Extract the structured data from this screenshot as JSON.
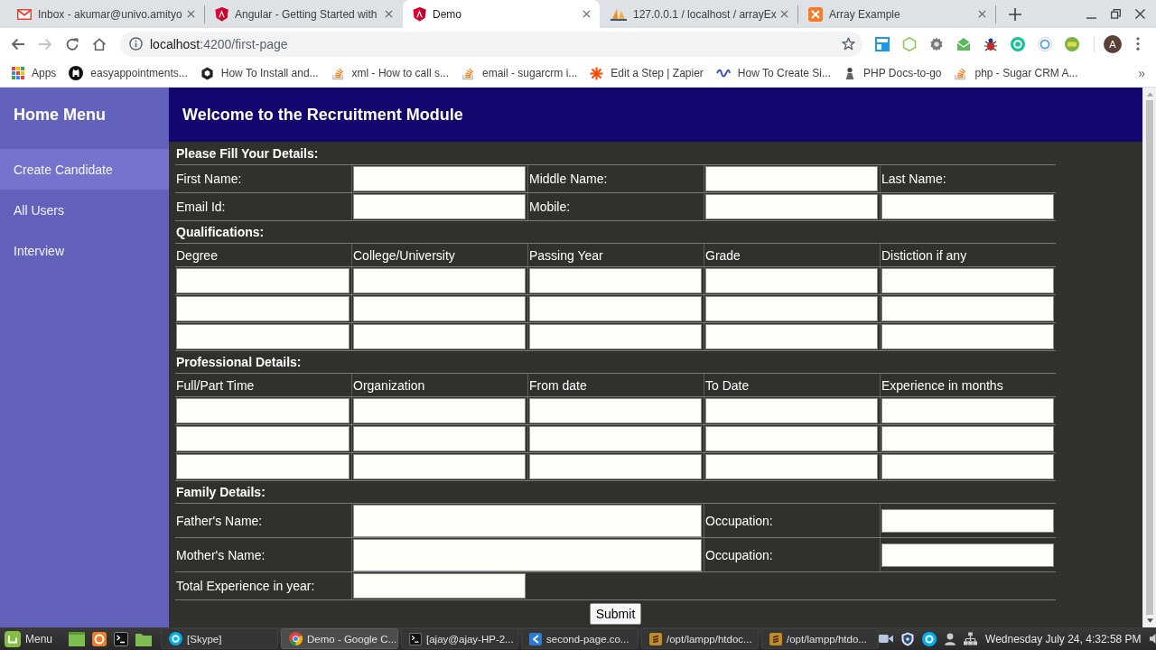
{
  "browser": {
    "tabs": [
      {
        "title": "Inbox - akumar@univo.amityo",
        "kind": "mail",
        "selected": false
      },
      {
        "title": "Angular - Getting Started with",
        "kind": "shield",
        "selected": false
      },
      {
        "title": "Demo",
        "kind": "shield",
        "selected": true
      },
      {
        "title": "127.0.0.1 / localhost / arrayEx",
        "kind": "sail",
        "selected": false
      },
      {
        "title": "Array Example",
        "kind": "tile",
        "selected": false
      }
    ],
    "forward_disabled": true,
    "address": {
      "host": "localhost",
      "path": ":4200/first-page"
    },
    "profile_initial": "A",
    "bookmarks": [
      {
        "label": "Apps",
        "kind": "apps"
      },
      {
        "label": "easyappointments...",
        "kind": "cat"
      },
      {
        "label": "How To Install and...",
        "kind": "hexagon"
      },
      {
        "label": "xml - How to call s...",
        "kind": "stack"
      },
      {
        "label": "email - sugarcrm i...",
        "kind": "stack"
      },
      {
        "label": "Edit a Step | Zapier",
        "kind": "asterisk"
      },
      {
        "label": "How To Create Si...",
        "kind": "squiggle"
      },
      {
        "label": "PHP Docs-to-go",
        "kind": "figure"
      },
      {
        "label": "php - Sugar CRM A...",
        "kind": "stack"
      }
    ],
    "bookmarks_overflow": "»"
  },
  "sidebar": {
    "title": "Home Menu",
    "items": [
      {
        "label": "Create Candidate",
        "selected": true
      },
      {
        "label": "All Users",
        "selected": false
      },
      {
        "label": "Interview",
        "selected": false
      }
    ]
  },
  "header": {
    "title": "Welcome to the Recruitment Module"
  },
  "form": {
    "rows": [
      {
        "kind": "heading",
        "text": "Please Fill Your Details:"
      },
      {
        "kind": "fields",
        "cells": [
          {
            "kind": "label",
            "text": "First Name:"
          },
          {
            "kind": "input"
          },
          {
            "kind": "label",
            "text": "Middle Name:"
          },
          {
            "kind": "input"
          },
          {
            "kind": "label",
            "text": "Last Name:"
          }
        ]
      },
      {
        "kind": "fields",
        "cells": [
          {
            "kind": "label",
            "text": "Email Id:"
          },
          {
            "kind": "input"
          },
          {
            "kind": "label",
            "text": "Mobile:"
          },
          {
            "kind": "input"
          },
          {
            "kind": "input"
          }
        ]
      },
      {
        "kind": "heading",
        "text": "Qualifications:"
      },
      {
        "kind": "columns",
        "cells": [
          {
            "kind": "label",
            "text": "Degree"
          },
          {
            "kind": "label",
            "text": "College/University"
          },
          {
            "kind": "label",
            "text": "Passing Year"
          },
          {
            "kind": "label",
            "text": "Grade"
          },
          {
            "kind": "label",
            "text": "Distiction if any"
          }
        ]
      },
      {
        "kind": "fields",
        "cells": [
          {
            "kind": "input"
          },
          {
            "kind": "input"
          },
          {
            "kind": "input"
          },
          {
            "kind": "input"
          },
          {
            "kind": "input"
          }
        ]
      },
      {
        "kind": "fields",
        "cells": [
          {
            "kind": "input"
          },
          {
            "kind": "input"
          },
          {
            "kind": "input"
          },
          {
            "kind": "input"
          },
          {
            "kind": "input"
          }
        ]
      },
      {
        "kind": "fields",
        "cells": [
          {
            "kind": "input"
          },
          {
            "kind": "input"
          },
          {
            "kind": "input"
          },
          {
            "kind": "input"
          },
          {
            "kind": "input"
          }
        ]
      },
      {
        "kind": "heading",
        "text": "Professional Details:"
      },
      {
        "kind": "columns",
        "cells": [
          {
            "kind": "label",
            "text": "Full/Part Time"
          },
          {
            "kind": "label",
            "text": "Organization"
          },
          {
            "kind": "label",
            "text": "From date"
          },
          {
            "kind": "label",
            "text": "To Date"
          },
          {
            "kind": "label",
            "text": "Experience in months"
          }
        ]
      },
      {
        "kind": "fields",
        "cells": [
          {
            "kind": "input"
          },
          {
            "kind": "input"
          },
          {
            "kind": "input"
          },
          {
            "kind": "input"
          },
          {
            "kind": "input"
          }
        ]
      },
      {
        "kind": "fields",
        "cells": [
          {
            "kind": "input"
          },
          {
            "kind": "input"
          },
          {
            "kind": "input"
          },
          {
            "kind": "input"
          },
          {
            "kind": "input"
          }
        ]
      },
      {
        "kind": "fields",
        "cells": [
          {
            "kind": "input"
          },
          {
            "kind": "input"
          },
          {
            "kind": "input"
          },
          {
            "kind": "input"
          },
          {
            "kind": "input"
          }
        ]
      },
      {
        "kind": "heading",
        "text": "Family Details:"
      },
      {
        "kind": "tall",
        "cells": [
          {
            "kind": "label",
            "text": "Father's Name:"
          },
          {
            "kind": "wide_input"
          },
          {
            "kind": "label",
            "text": "Occupation:"
          },
          {
            "kind": "input"
          }
        ]
      },
      {
        "kind": "tall",
        "cells": [
          {
            "kind": "label",
            "text": "Mother's Name:"
          },
          {
            "kind": "wide_input"
          },
          {
            "kind": "label",
            "text": "Occupation:"
          },
          {
            "kind": "input"
          }
        ]
      },
      {
        "kind": "fields",
        "cells": [
          {
            "kind": "label",
            "text": "Total Experience in year:"
          },
          {
            "kind": "input"
          }
        ]
      },
      {
        "kind": "submit",
        "label": "Submit"
      }
    ]
  },
  "taskbar": {
    "menu_label": "Menu",
    "windows": [
      {
        "label": "[Skype]",
        "kind": "disc",
        "selected": false
      },
      {
        "label": "Demo - Google C...",
        "kind": "round",
        "selected": true
      },
      {
        "label": "[ajay@ajay-HP-2...",
        "kind": "terminal",
        "selected": false
      },
      {
        "label": "second-page.co...",
        "kind": "code",
        "selected": false
      },
      {
        "label": "/opt/lampp/htdoc...",
        "kind": "tile",
        "selected": false
      },
      {
        "label": "/opt/lampp/htdo...",
        "kind": "tile",
        "selected": false
      }
    ],
    "clock": "Wednesday July 24, 4:32:58 PM"
  }
}
